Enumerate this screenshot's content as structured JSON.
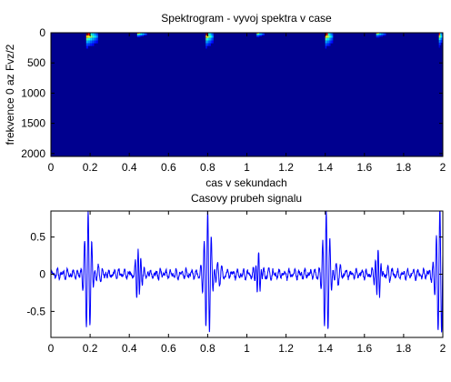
{
  "chart_data": [
    {
      "type": "heatmap",
      "title": "Spektrogram - vyvoj spektra v case",
      "xlabel": "cas v sekundach",
      "ylabel": "frekvence 0 az Fvz/2",
      "xlim": [
        0,
        2
      ],
      "ylim": [
        0,
        2048
      ],
      "y_reversed": true,
      "x_ticks": [
        "0",
        "0.2",
        "0.4",
        "0.6",
        "0.8",
        "1",
        "1.2",
        "1.4",
        "1.6",
        "1.8",
        "2"
      ],
      "y_ticks": [
        "0",
        "500",
        "1000",
        "1500",
        "2000"
      ],
      "colormap": "jet",
      "background_color": "#00008f",
      "energy_bursts": [
        {
          "t": 0.18,
          "t_end": 0.24,
          "f_max": 350,
          "peak": 1.0
        },
        {
          "t": 0.44,
          "t_end": 0.49,
          "f_max": 120,
          "peak": 0.75
        },
        {
          "t": 0.79,
          "t_end": 0.83,
          "f_max": 350,
          "peak": 1.0
        },
        {
          "t": 1.05,
          "t_end": 1.09,
          "f_max": 120,
          "peak": 0.7
        },
        {
          "t": 1.4,
          "t_end": 1.44,
          "f_max": 350,
          "peak": 1.0
        },
        {
          "t": 1.66,
          "t_end": 1.71,
          "f_max": 130,
          "peak": 0.7
        },
        {
          "t": 1.98,
          "t_end": 2.0,
          "f_max": 330,
          "peak": 0.9
        }
      ]
    },
    {
      "type": "line",
      "title": "Casovy prubeh signalu",
      "xlim": [
        0,
        2
      ],
      "ylim": [
        -0.85,
        0.85
      ],
      "x_ticks": [
        "0",
        "0.2",
        "0.4",
        "0.6",
        "0.8",
        "1",
        "1.2",
        "1.4",
        "1.6",
        "1.8",
        "2"
      ],
      "y_ticks": [
        "0.5",
        "0",
        "-0.5"
      ],
      "color": "#0000ff",
      "events": [
        {
          "t": 0.19,
          "amp": 0.82,
          "kind": "major"
        },
        {
          "t": 0.445,
          "amp": 0.33,
          "kind": "minor"
        },
        {
          "t": 0.8,
          "amp": 0.82,
          "kind": "major"
        },
        {
          "t": 1.06,
          "amp": 0.28,
          "kind": "minor"
        },
        {
          "t": 1.405,
          "amp": 0.82,
          "kind": "major"
        },
        {
          "t": 1.67,
          "amp": 0.32,
          "kind": "minor"
        },
        {
          "t": 1.985,
          "amp": 0.85,
          "kind": "major"
        }
      ]
    }
  ]
}
